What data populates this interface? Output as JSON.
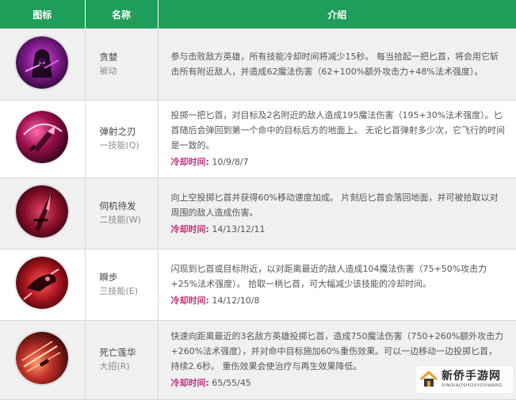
{
  "headers": {
    "icon": "图标",
    "name": "名称",
    "desc": "介绍"
  },
  "cooldown_label": "冷却时间:",
  "skills": [
    {
      "icon": "hooded-assassin-icon",
      "name": "贪婪",
      "type": "被动",
      "desc": "参与击败敌方英雄，所有技能冷却时间将减少15秒。 每当拾起一把匕首，将会用它斩击所有附近敌人，并造成62魔法伤害（62+100%额外攻击力+48%法术强度）。",
      "cooldown": ""
    },
    {
      "icon": "bouncing-blade-icon",
      "name": "弹射之刃",
      "type": "一技能(Q)",
      "desc": "投掷一把匕首，对目标及2名附近的敌人造成195魔法伤害（195+30%法术强度）。匕首随后会弹回到第一个命中的目标后方的地面上。 无论匕首弹射多少次，它飞行的时间是一致的。",
      "cooldown": "10/9/8/7"
    },
    {
      "icon": "dagger-throw-icon",
      "name": "伺机待发",
      "type": "二技能(W)",
      "desc": "向上空投掷匕首并获得60%移动速度加成。 片刻后匕首会落回地面，并可被拾取以对周围的敌人造成伤害。",
      "cooldown": "14/13/12/11"
    },
    {
      "icon": "shunpo-icon",
      "name": "瞬步",
      "type": "三技能(E)",
      "desc": "闪现到匕首或目标附近，以对距离最近的敌人造成104魔法伤害（75+50%攻击力+25%法术强度）。 拾取一柄匕首，可大幅减少该技能的冷却时间。",
      "cooldown": "14/12/10/8"
    },
    {
      "icon": "death-lotus-icon",
      "name": "死亡莲华",
      "type": "大招(R)",
      "desc": "快速向距离最近的3名敌方英雄投掷匕首，造成750魔法伤害（750+260%额外攻击力+260%法术强度），并对命中目标施加60%重伤效果。可以一边移动一边投掷匕首，持续2.6秒。 重伤效果会使治疗与再生效果降低。",
      "cooldown": "65/55/45"
    }
  ],
  "watermark": {
    "main": "新侨手游网",
    "sub": "XINQIAOSHOUYOUWANG"
  }
}
